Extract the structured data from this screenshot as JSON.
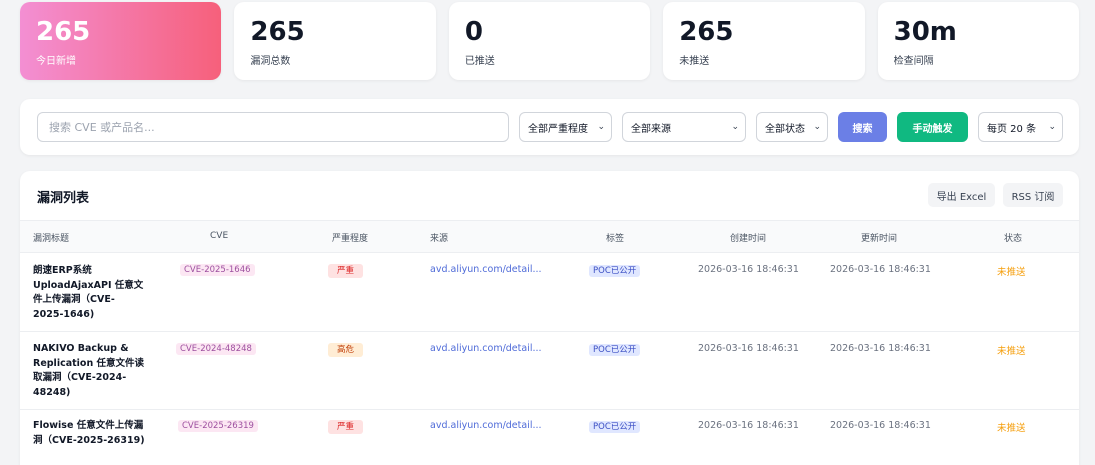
{
  "stats": [
    {
      "value": "265",
      "label": "今日新增"
    },
    {
      "value": "265",
      "label": "漏洞总数"
    },
    {
      "value": "0",
      "label": "已推送"
    },
    {
      "value": "265",
      "label": "未推送"
    },
    {
      "value": "30m",
      "label": "检查间隔"
    }
  ],
  "filter": {
    "search_placeholder": "搜索 CVE 或产品名...",
    "severity": "全部严重程度",
    "source": "全部来源",
    "status": "全部状态",
    "search_btn": "搜索",
    "trigger_btn": "手动触发",
    "page_size": "每页 20 条"
  },
  "colors": {
    "search_btn": "#6b7fe6",
    "trigger_btn": "#10b981"
  },
  "table": {
    "title": "漏洞列表",
    "export_btn": "导出 Excel",
    "rss_btn": "RSS 订阅",
    "headers": [
      "漏洞标题",
      "CVE",
      "严重程度",
      "来源",
      "标签",
      "创建时间",
      "更新时间",
      "状态"
    ],
    "rows": [
      {
        "title": "朗速ERP系统 UploadAjaxAPI 任意文件上传漏洞（CVE-2025-1646)",
        "cve": "CVE-2025-1646",
        "severity": "严重",
        "source": "avd.aliyun.com/detail...",
        "tag": "POC已公开",
        "created": "2026-03-16 18:46:31",
        "updated": "2026-03-16 18:46:31",
        "status": "未推送"
      },
      {
        "title": "NAKIVO Backup & Replication 任意文件读取漏洞（CVE-2024-48248)",
        "cve": "CVE-2024-48248",
        "severity": "高危",
        "source": "avd.aliyun.com/detail...",
        "tag": "POC已公开",
        "created": "2026-03-16 18:46:31",
        "updated": "2026-03-16 18:46:31",
        "status": "未推送"
      },
      {
        "title": "Flowise 任意文件上传漏洞（CVE-2025-26319)",
        "cve": "CVE-2025-26319",
        "severity": "严重",
        "source": "avd.aliyun.com/detail...",
        "tag": "POC已公开",
        "created": "2026-03-16 18:46:31",
        "updated": "2026-03-16 18:46:31",
        "status": "未推送"
      }
    ]
  }
}
